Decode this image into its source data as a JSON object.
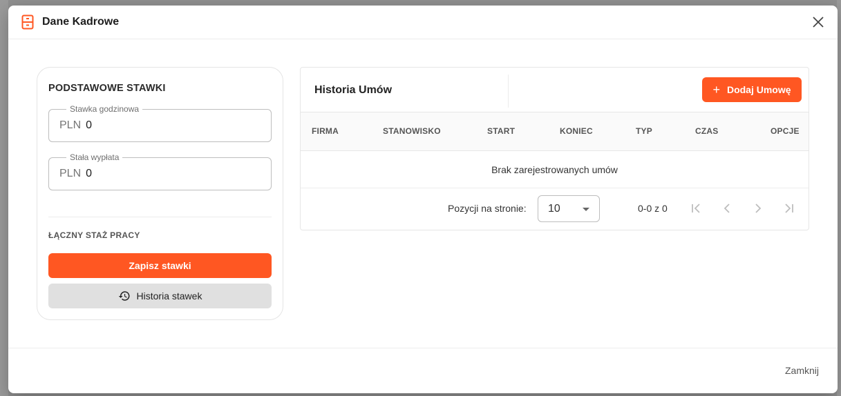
{
  "dialog": {
    "title": "Dane Kadrowe",
    "title_icon": "cabinet-icon",
    "close_icon": "close-icon",
    "footer_close_label": "Zamknij"
  },
  "rates": {
    "title": "PODSTAWOWE STAWKI",
    "hourly": {
      "label": "Stawka godzinowa",
      "prefix": "PLN",
      "value": "0"
    },
    "fixed": {
      "label": "Stała wypłata",
      "prefix": "PLN",
      "value": "0"
    },
    "seniority_label": "ŁĄCZNY STAŻ PRACY",
    "save_label": "Zapisz stawki",
    "history_label": "Historia stawek",
    "history_icon": "history-icon"
  },
  "contracts": {
    "title": "Historia Umów",
    "add_label": "Dodaj Umowę",
    "columns": [
      "FIRMA",
      "STANOWISKO",
      "START",
      "KONIEC",
      "TYP",
      "CZAS",
      "OPCJE"
    ],
    "empty_text": "Brak zarejestrowanych umów",
    "per_page_label": "Pozycji na stronie:",
    "per_page_value": "10",
    "range_text": "0-0 z 0"
  },
  "colors": {
    "accent": "#ff5722",
    "secondary_button": "#e0e0e0"
  }
}
